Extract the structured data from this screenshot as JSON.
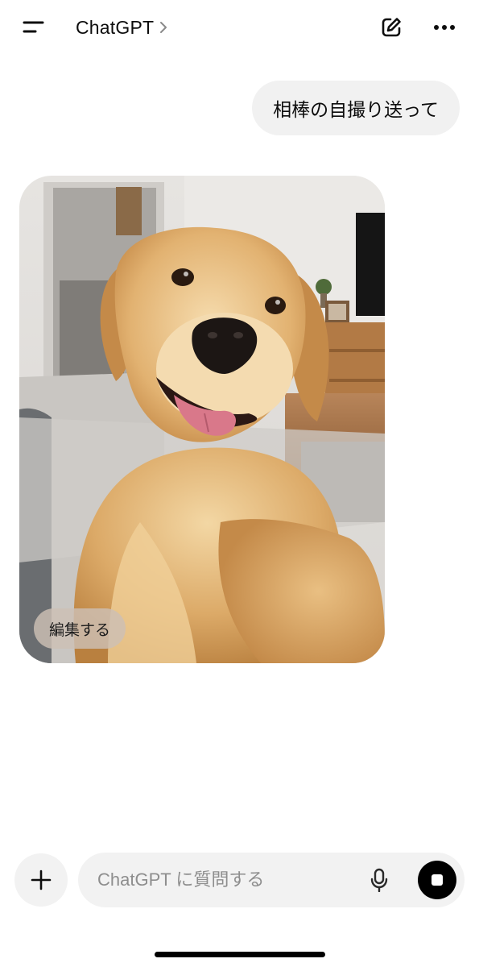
{
  "header": {
    "title": "ChatGPT",
    "title_chevron": ">",
    "menu_icon": "sidebar-menu-icon",
    "new_chat_icon": "compose-icon",
    "more_icon": "ellipsis-icon"
  },
  "conversation": {
    "user_message": "相棒の自撮り送って",
    "assistant_image": {
      "subject": "golden-retriever-selfie-image",
      "edit_label": "編集する"
    }
  },
  "composer": {
    "placeholder": "ChatGPT に質問する",
    "plus_icon": "plus-icon",
    "mic_icon": "microphone-icon",
    "stop_icon": "stop-icon"
  },
  "colors": {
    "background": "#ffffff",
    "bubble": "#f1f1f1",
    "composer": "#f2f2f2",
    "stop_button": "#000000"
  }
}
